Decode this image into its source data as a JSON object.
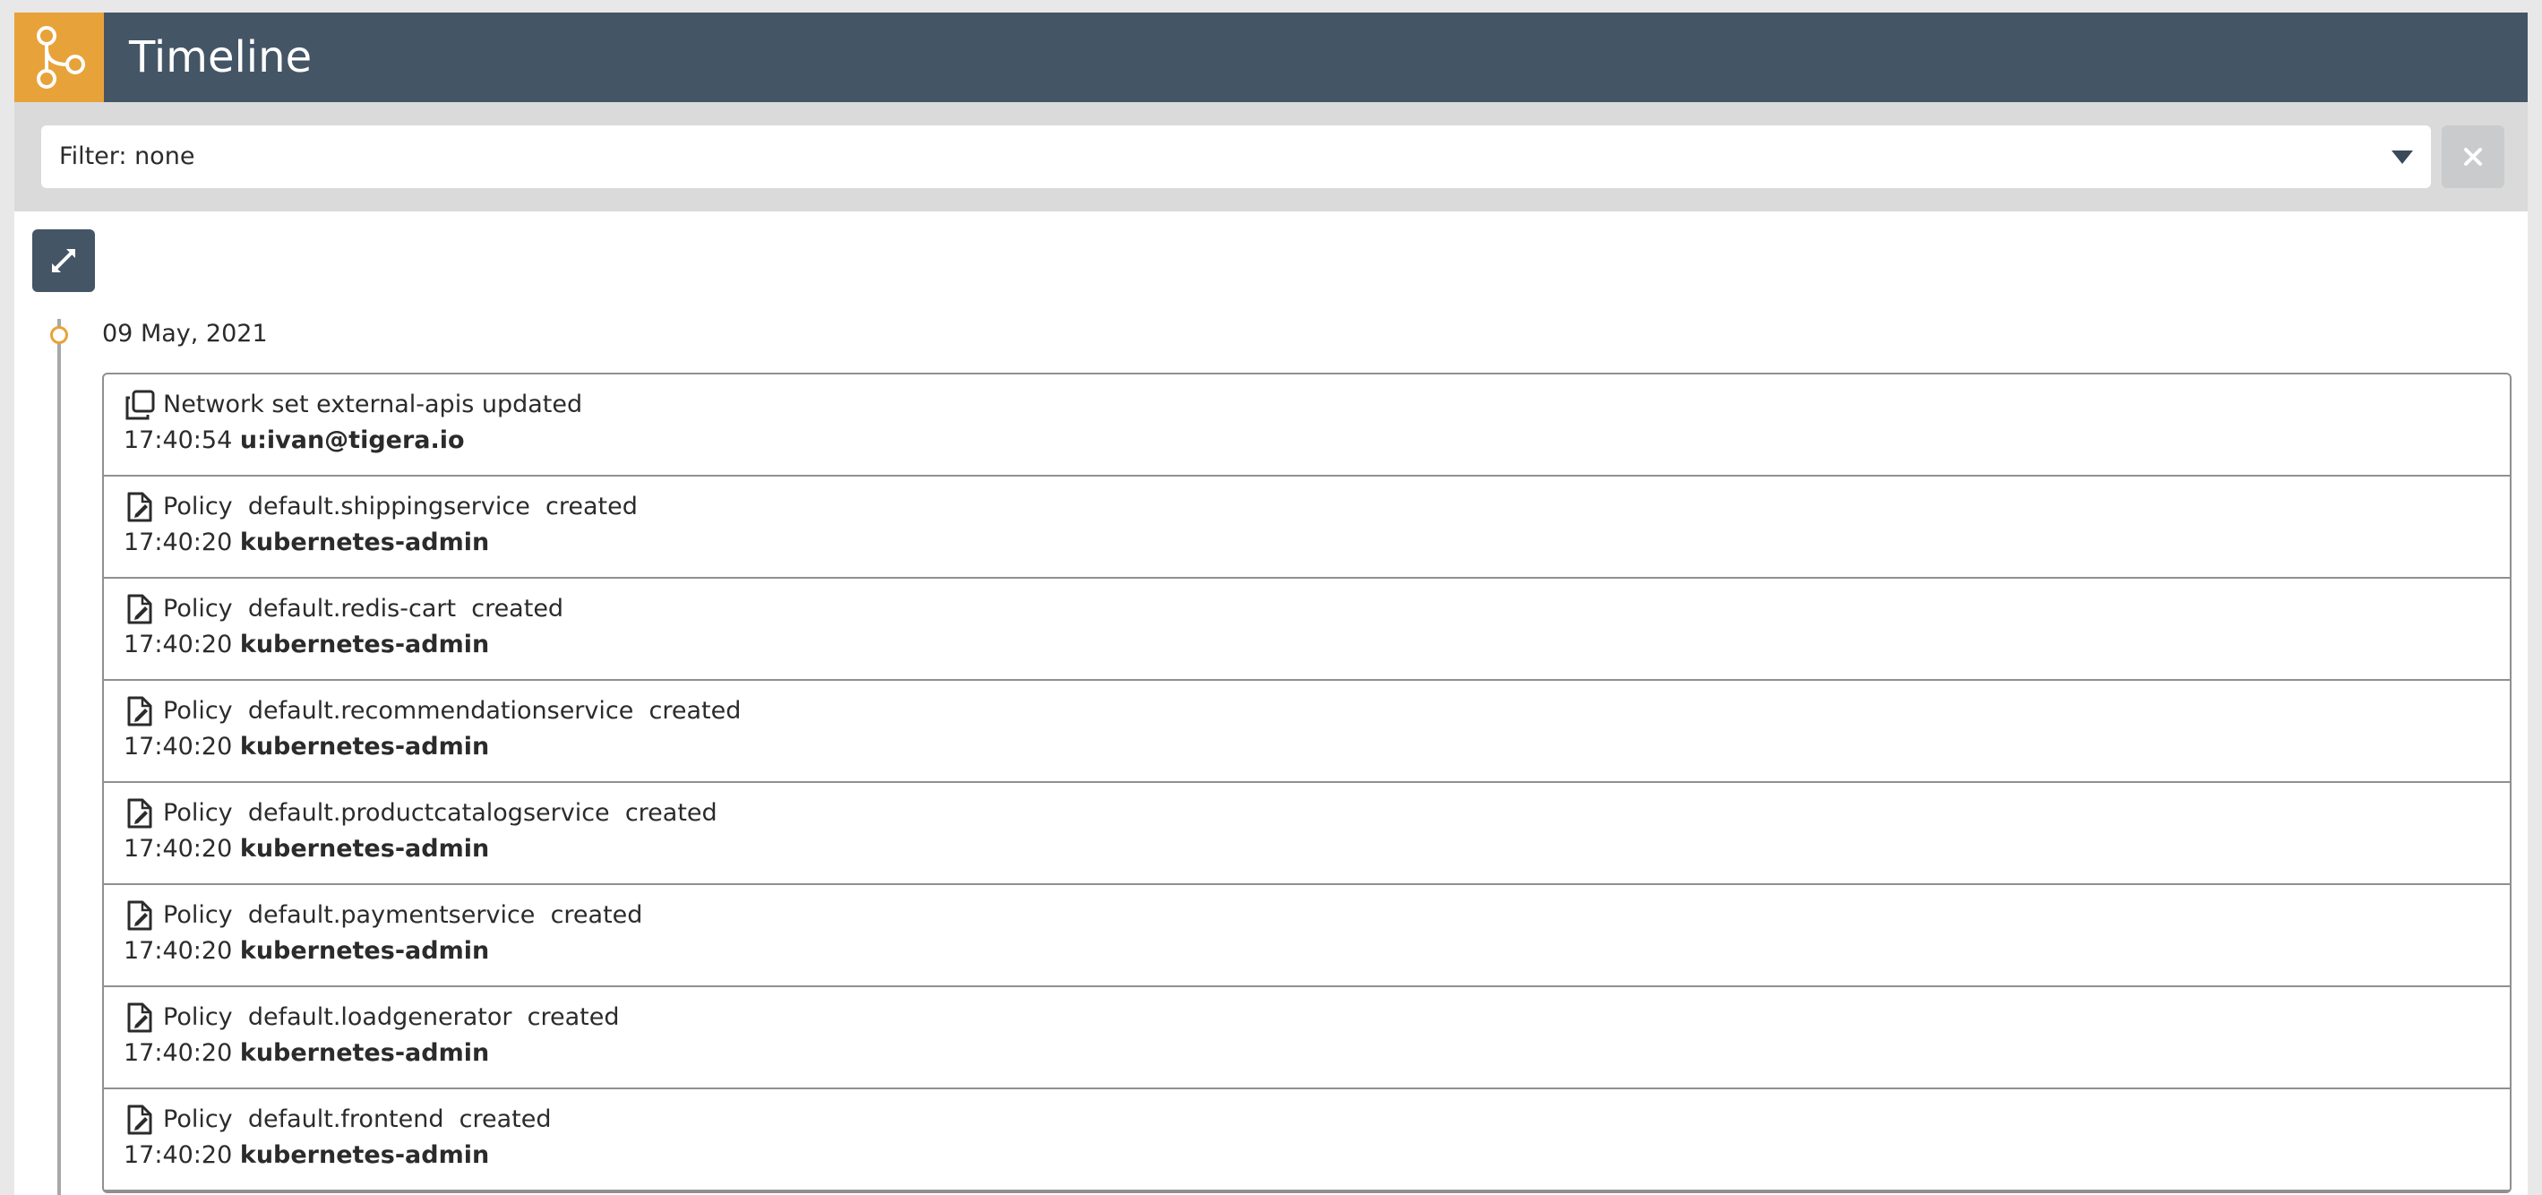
{
  "header": {
    "title": "Timeline",
    "logo_icon": "branch-icon",
    "logo_color": "#e8a23a",
    "bar_color": "#445566"
  },
  "filter": {
    "value": "Filter: none",
    "dropdown_icon": "caret-down-icon",
    "clear_icon": "close-icon"
  },
  "toolbar": {
    "expand_icon": "expand-icon"
  },
  "timeline": {
    "date": "09 May, 2021",
    "events": [
      {
        "icon": "copy-icon",
        "title": "Network set external-apis updated",
        "time": "17:40:54",
        "user": "u:ivan@tigera.io"
      },
      {
        "icon": "file-edit-icon",
        "title": "Policy  default.shippingservice  created",
        "time": "17:40:20",
        "user": "kubernetes-admin"
      },
      {
        "icon": "file-edit-icon",
        "title": "Policy  default.redis-cart  created",
        "time": "17:40:20",
        "user": "kubernetes-admin"
      },
      {
        "icon": "file-edit-icon",
        "title": "Policy  default.recommendationservice  created",
        "time": "17:40:20",
        "user": "kubernetes-admin"
      },
      {
        "icon": "file-edit-icon",
        "title": "Policy  default.productcatalogservice  created",
        "time": "17:40:20",
        "user": "kubernetes-admin"
      },
      {
        "icon": "file-edit-icon",
        "title": "Policy  default.paymentservice  created",
        "time": "17:40:20",
        "user": "kubernetes-admin"
      },
      {
        "icon": "file-edit-icon",
        "title": "Policy  default.loadgenerator  created",
        "time": "17:40:20",
        "user": "kubernetes-admin"
      },
      {
        "icon": "file-edit-icon",
        "title": "Policy  default.frontend  created",
        "time": "17:40:20",
        "user": "kubernetes-admin"
      }
    ]
  }
}
